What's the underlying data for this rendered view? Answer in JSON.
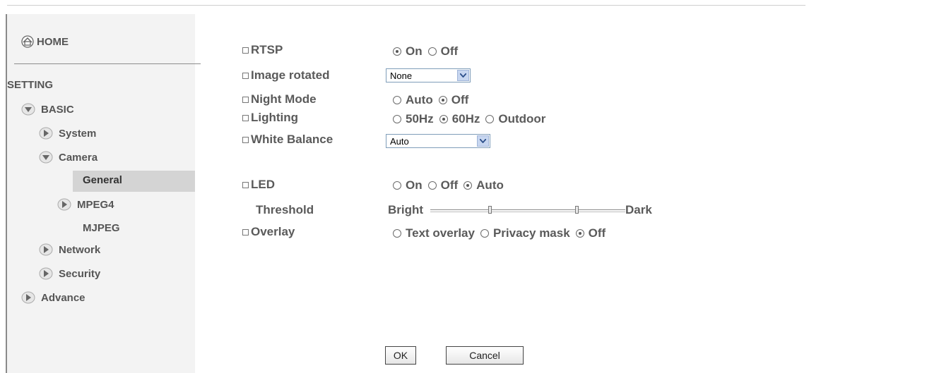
{
  "sidebar": {
    "home": "HOME",
    "setting": "SETTING",
    "basic": "BASIC",
    "system": "System",
    "camera": "Camera",
    "general": "General",
    "mpeg4": "MPEG4",
    "mjpeg": "MJPEG",
    "network": "Network",
    "security": "Security",
    "advance": "Advance"
  },
  "form": {
    "rtsp": {
      "label": "RTSP",
      "options": [
        "On",
        "Off"
      ],
      "selected": "On"
    },
    "image_rotated": {
      "label": "Image rotated",
      "value": "None"
    },
    "night_mode": {
      "label": "Night Mode",
      "options": [
        "Auto",
        "Off"
      ],
      "selected": "Off"
    },
    "lighting": {
      "label": "Lighting",
      "options": [
        "50Hz",
        "60Hz",
        "Outdoor"
      ],
      "selected": "60Hz"
    },
    "white_balance": {
      "label": "White Balance",
      "value": "Auto"
    },
    "led": {
      "label": "LED",
      "options": [
        "On",
        "Off",
        "Auto"
      ],
      "selected": "Auto"
    },
    "threshold": {
      "label": "Threshold",
      "left": "Bright",
      "right": "Dark"
    },
    "overlay": {
      "label": "Overlay",
      "options": [
        "Text overlay",
        "Privacy mask",
        "Off"
      ],
      "selected": "Off"
    }
  },
  "buttons": {
    "ok": "OK",
    "cancel": "Cancel"
  },
  "colors": {
    "sidebar_bg": "#f3f3f3",
    "selected_bg": "#d4d4d4",
    "text": "#555555",
    "select_border": "#7f9db9"
  }
}
